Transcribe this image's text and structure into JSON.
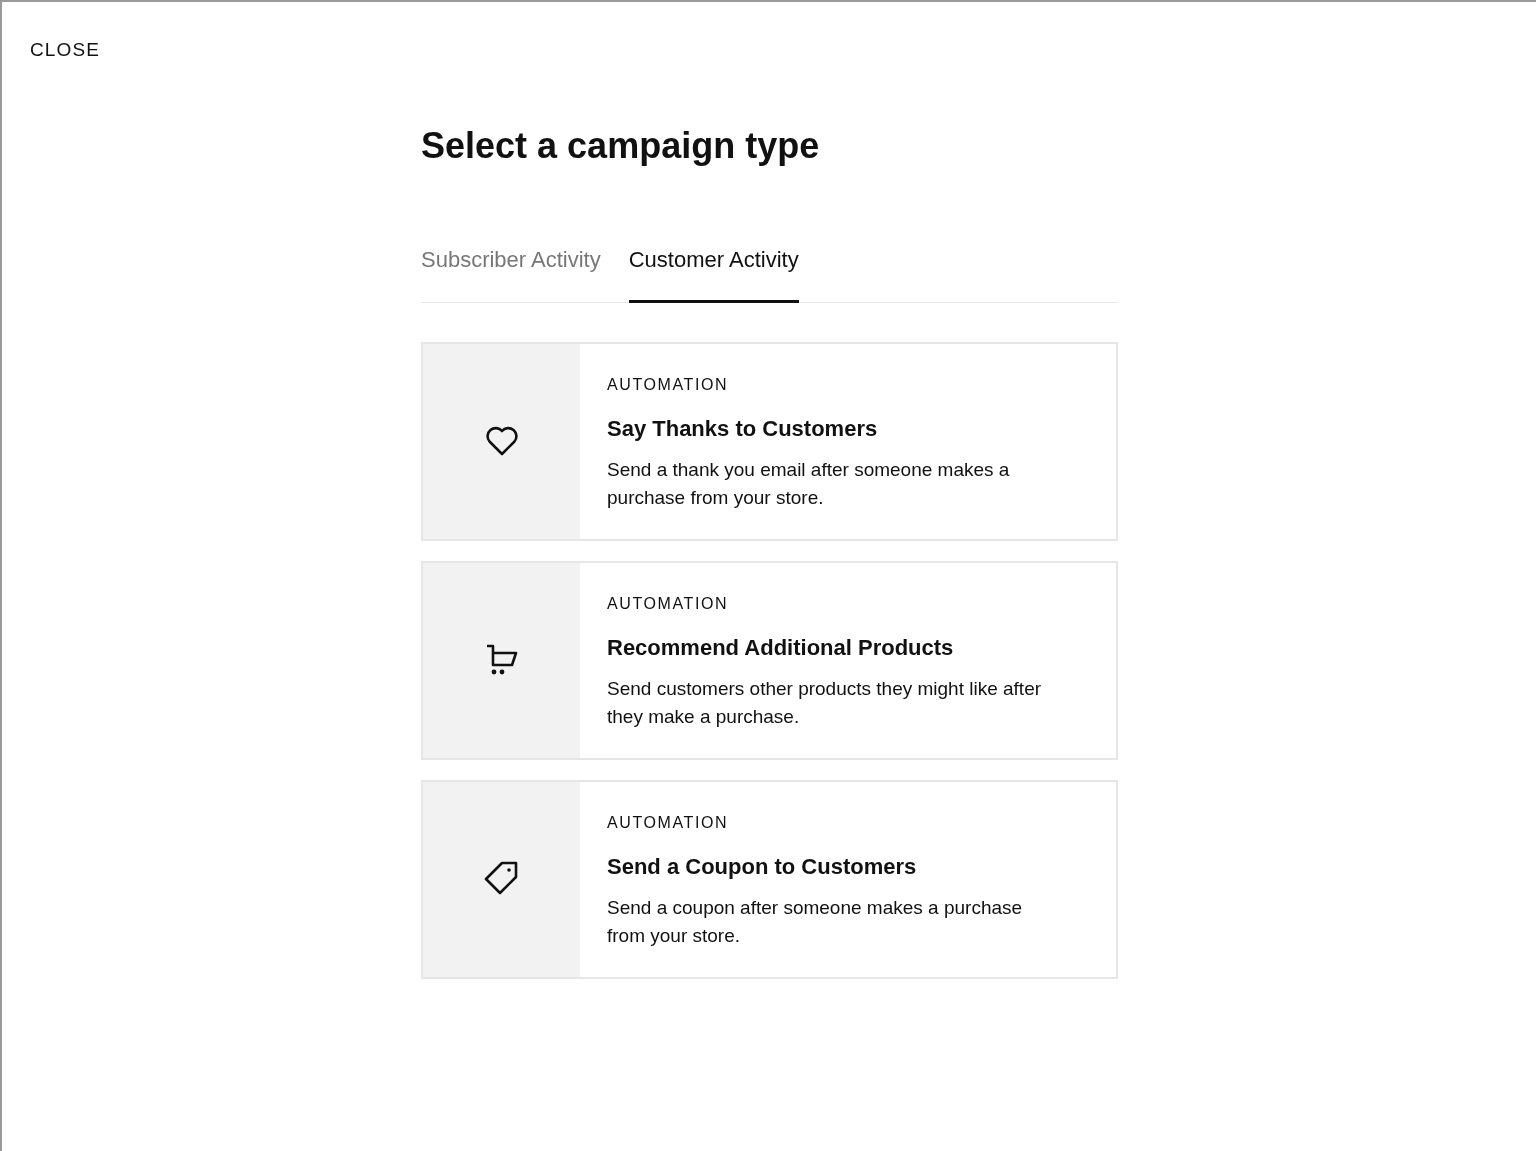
{
  "close_button": "CLOSE",
  "title": "Select a campaign type",
  "tabs": [
    {
      "label": "Subscriber Activity",
      "selected": false
    },
    {
      "label": "Customer Activity",
      "selected": true
    }
  ],
  "cards": [
    {
      "label": "AUTOMATION",
      "title": "Say Thanks to Customers",
      "description": "Send a thank you email after someone makes a purchase from your store."
    },
    {
      "label": "AUTOMATION",
      "title": "Recommend Additional Products",
      "description": "Send customers other products they might like after they make a purchase."
    },
    {
      "label": "AUTOMATION",
      "title": "Send a Coupon to Customers",
      "description": "Send a coupon after someone makes a purchase from your store."
    }
  ]
}
